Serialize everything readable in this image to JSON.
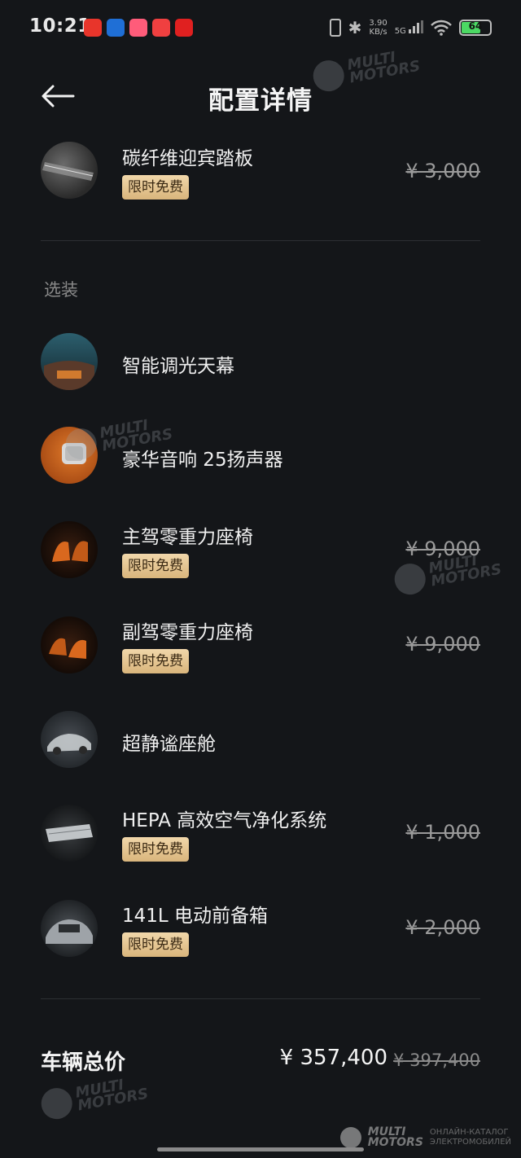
{
  "status_bar": {
    "time": "10:21",
    "net_speed_value": "3.90",
    "net_speed_unit": "KB/s",
    "signal": "5G",
    "battery": "64",
    "notification_colors": [
      "#e8352b",
      "#1f6fd6",
      "#ff5c7a",
      "#f04040",
      "#e02020"
    ]
  },
  "header": {
    "title": "配置详情"
  },
  "standard_items": [
    {
      "name": "碳纤维迎宾踏板",
      "badge": "限时免费",
      "price": "¥ 3,000",
      "thumb": "carbon-step-plate"
    }
  ],
  "section": {
    "optional_title": "选装"
  },
  "optional_items": [
    {
      "name": "智能调光天幕",
      "thumb": "smart-dimming-sunroof"
    },
    {
      "name": "豪华音响 25扬声器",
      "thumb": "premium-speaker"
    },
    {
      "name": "主驾零重力座椅",
      "badge": "限时免费",
      "price": "¥ 9,000",
      "thumb": "driver-seat"
    },
    {
      "name": "副驾零重力座椅",
      "badge": "限时免费",
      "price": "¥ 9,000",
      "thumb": "passenger-seat"
    },
    {
      "name": "超静谧座舱",
      "thumb": "quiet-cabin"
    },
    {
      "name": "HEPA 高效空气净化系统",
      "badge": "限时免费",
      "price": "¥ 1,000",
      "thumb": "hepa-filter"
    },
    {
      "name": "141L 电动前备箱",
      "badge": "限时免费",
      "price": "¥ 2,000",
      "thumb": "front-trunk"
    }
  ],
  "total": {
    "label": "车辆总价",
    "price": "¥ 357,400",
    "original_price": "¥ 397,400"
  },
  "watermark": {
    "line1": "MULTI",
    "line2": "MOTORS",
    "footer_sub1": "ОНЛАЙН-КАТАЛОГ",
    "footer_sub2": "ЭЛЕКТРОМОБИЛЕЙ"
  }
}
